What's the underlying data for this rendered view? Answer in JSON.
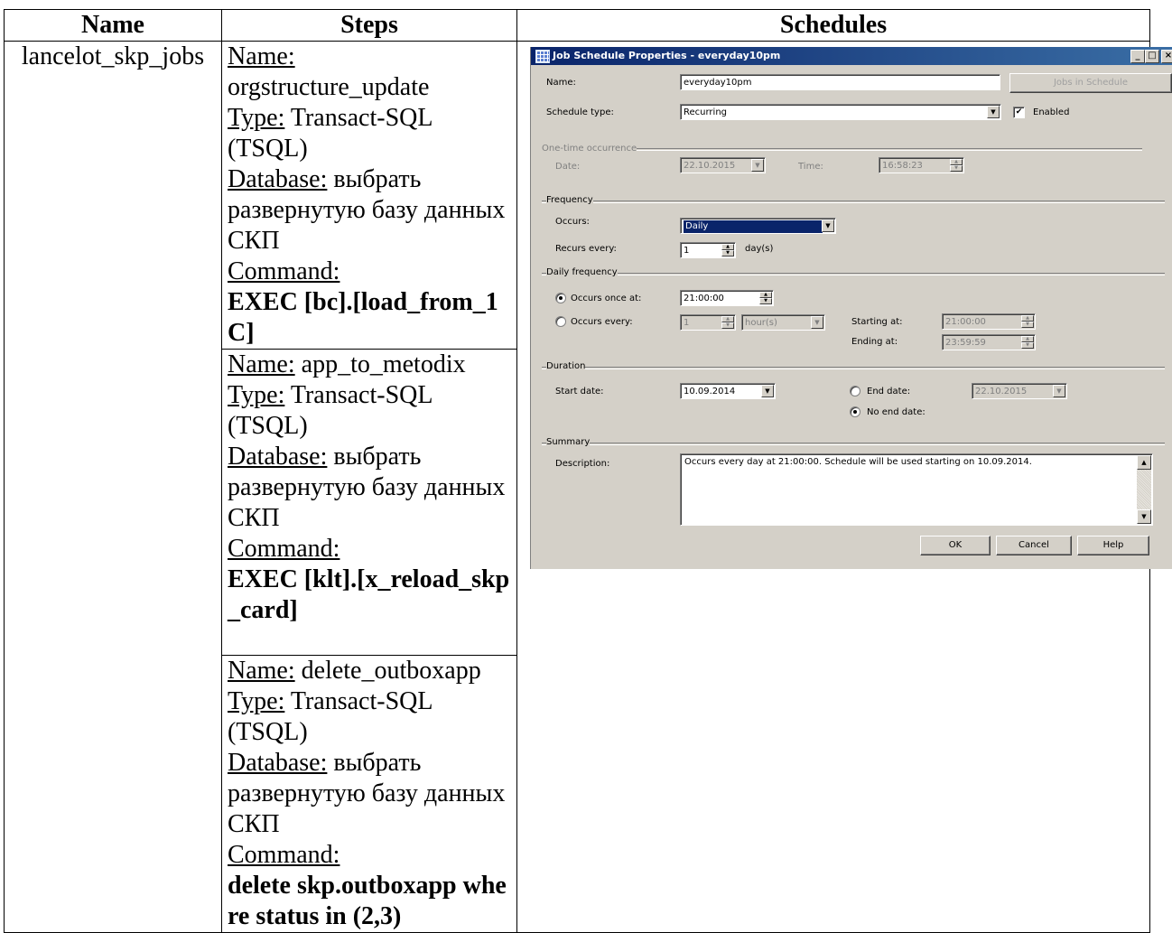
{
  "table": {
    "headers": {
      "name": "Name",
      "steps": "Steps",
      "schedules": "Schedules"
    },
    "job_name": "lancelot_skp_jobs",
    "steps": [
      {
        "name_label": "Name:",
        "name": "orgstructure_update",
        "type_label": "Type:",
        "type": "Transact-SQL (TSQL)",
        "db_label": "Database:",
        "db": "выбрать развернутую базу данных СКП",
        "cmd_label": "Command:",
        "cmd": "EXEC [bc].[load_from_1C]"
      },
      {
        "name_label": "Name:",
        "name": "app_to_metodix",
        "type_label": "Type:",
        "type": "Transact-SQL (TSQL)",
        "db_label": "Database:",
        "db": "выбрать развернутую базу данных СКП",
        "cmd_label": "Command:",
        "cmd": "EXEC [klt].[x_reload_skp_card]"
      },
      {
        "name_label": "Name:",
        "name": "delete_outboxapp",
        "type_label": "Type:",
        "type": "Transact-SQL (TSQL)",
        "db_label": "Database:",
        "db": "выбрать развернутую базу данных СКП",
        "cmd_label": "Command:",
        "cmd": "delete skp.outboxapp where status in (2,3)"
      }
    ]
  },
  "dialog": {
    "title": "Job Schedule Properties - everyday10pm",
    "name_label": "Name:",
    "name_value": "everyday10pm",
    "jobs_button": "Jobs in Schedule",
    "schedule_type_label": "Schedule type:",
    "schedule_type_value": "Recurring",
    "enabled_label": "Enabled",
    "onetime_group": "One-time occurrence",
    "date_label": "Date:",
    "date_value": "22.10.2015",
    "time_label": "Time:",
    "time_value": "16:58:23",
    "frequency_group": "Frequency",
    "occurs_label": "Occurs:",
    "occurs_value": "Daily",
    "recurs_label": "Recurs every:",
    "recurs_value": "1",
    "recurs_unit": "day(s)",
    "daily_group": "Daily frequency",
    "once_label": "Occurs once at:",
    "once_value": "21:00:00",
    "every_label": "Occurs every:",
    "every_value": "1",
    "every_unit": "hour(s)",
    "starting_label": "Starting at:",
    "starting_value": "21:00:00",
    "ending_label": "Ending at:",
    "ending_value": "23:59:59",
    "duration_group": "Duration",
    "start_label": "Start date:",
    "start_value": "10.09.2014",
    "end_label": "End date:",
    "end_value": "22.10.2015",
    "noend_label": "No end date:",
    "summary_group": "Summary",
    "description_label": "Description:",
    "description_value": "Occurs every day at 21:00:00. Schedule will be used starting on 10.09.2014.",
    "ok": "OK",
    "cancel": "Cancel",
    "help": "Help"
  }
}
